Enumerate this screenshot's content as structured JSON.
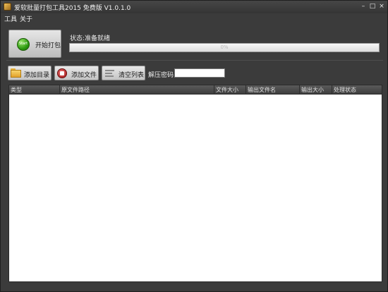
{
  "window": {
    "title": "爱软批量打包工具2015 免费版 V1.0.1.0",
    "controls": {
      "minimize": "–",
      "maximize": "□",
      "close": "×"
    }
  },
  "menu": {
    "items": [
      "工具",
      "关于"
    ]
  },
  "top_panel": {
    "start_button": {
      "label": "开始打包",
      "icon": "start-icon",
      "icon_text": "Start"
    },
    "status_text": "状态:准备就绪",
    "progress": {
      "percent": 0,
      "text": "0%"
    }
  },
  "toolbar": {
    "add_dir": {
      "label": "添加目录",
      "icon": "folder-icon"
    },
    "add_file": {
      "label": "添加文件",
      "icon": "file-icon"
    },
    "clear_list": {
      "label": "清空列表",
      "icon": "list-icon"
    },
    "password_label": "解压密码",
    "password_value": ""
  },
  "table": {
    "columns": [
      "类型",
      "原文件路径",
      "文件大小",
      "输出文件名",
      "输出大小",
      "处理状态"
    ],
    "rows": []
  },
  "colors": {
    "background": "#3b3b3b",
    "table_bg": "#ffffff",
    "header_bg": "#4a4a4a",
    "button_bg": "#d6d6d6"
  }
}
